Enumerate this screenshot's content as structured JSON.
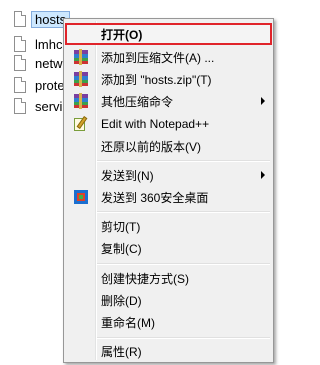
{
  "files": [
    {
      "name": "hosts",
      "selected": true,
      "icon": "file-icon"
    },
    {
      "name": "lmhc",
      "selected": false,
      "icon": "file-icon"
    },
    {
      "name": "netw",
      "selected": false,
      "icon": "file-icon"
    },
    {
      "name": "prote",
      "selected": false,
      "icon": "file-icon"
    },
    {
      "name": "servi",
      "selected": false,
      "icon": "file-icon"
    }
  ],
  "menu": {
    "open": "打开(O)",
    "add_archive": "添加到压缩文件(A) ...",
    "add_zip": "添加到 \"hosts.zip\"(T)",
    "other_compress": "其他压缩命令",
    "edit_npp": "Edit with Notepad++",
    "restore_prev": "还原以前的版本(V)",
    "send_to": "发送到(N)",
    "send_360": "发送到 360安全桌面",
    "cut": "剪切(T)",
    "copy": "复制(C)",
    "create_shortcut": "创建快捷方式(S)",
    "delete": "删除(D)",
    "rename": "重命名(M)",
    "properties": "属性(R)"
  },
  "colors": {
    "highlight_border": "#e0242a",
    "menu_background": "#f0f0f0",
    "selection": "#cde8ff"
  },
  "icons": {
    "archive": "winrar-icon",
    "notepad": "notepad-plus-plus-icon",
    "desktop_360": "360-desktop-icon",
    "submenu": "submenu-arrow-icon"
  }
}
